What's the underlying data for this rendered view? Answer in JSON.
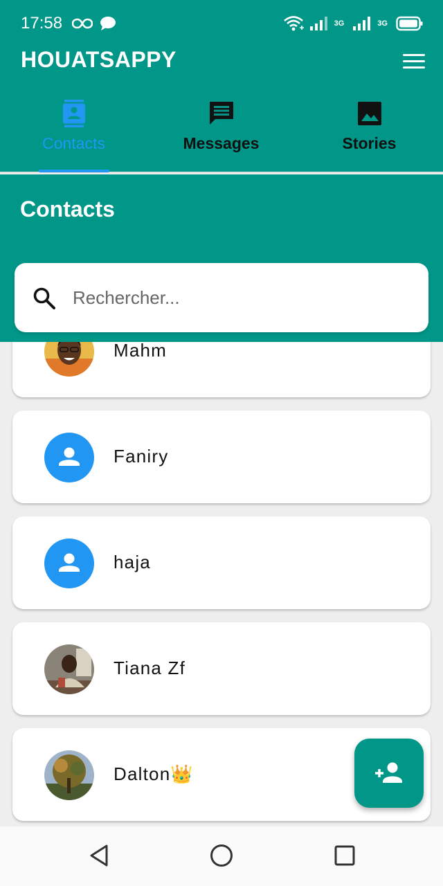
{
  "status_bar": {
    "time": "17:58",
    "left_icons": [
      "infinity-icon",
      "chat-bubble-icon"
    ],
    "network_label_1": "3G",
    "network_label_2": "3G",
    "right_icons": [
      "wifi-icon",
      "signal-icon",
      "signal-icon",
      "battery-icon"
    ]
  },
  "app_bar": {
    "title": "HOUATSAPPY",
    "menu_icon": "hamburger-menu-icon"
  },
  "tabs": [
    {
      "label": "Contacts",
      "icon": "contacts-book-icon",
      "active": true
    },
    {
      "label": "Messages",
      "icon": "message-icon",
      "active": false
    },
    {
      "label": "Stories",
      "icon": "image-icon",
      "active": false
    }
  ],
  "section": {
    "title": "Contacts"
  },
  "search": {
    "placeholder": "Rechercher...",
    "value": "",
    "icon": "search-icon"
  },
  "contacts": [
    {
      "name": "Mahm",
      "avatar": "photo"
    },
    {
      "name": "Faniry",
      "avatar": "generic-person-icon"
    },
    {
      "name": "haja",
      "avatar": "generic-person-icon"
    },
    {
      "name": "Tiana Zf",
      "avatar": "photo"
    },
    {
      "name": "Dalton👑",
      "avatar": "photo"
    }
  ],
  "fab": {
    "icon": "add-person-icon"
  },
  "nav_bar": {
    "icons": [
      "back-triangle-icon",
      "home-circle-icon",
      "recents-square-icon"
    ]
  },
  "colors": {
    "primary": "#009688",
    "accent": "#2196f3",
    "background": "#eeeeee",
    "card": "#ffffff"
  }
}
